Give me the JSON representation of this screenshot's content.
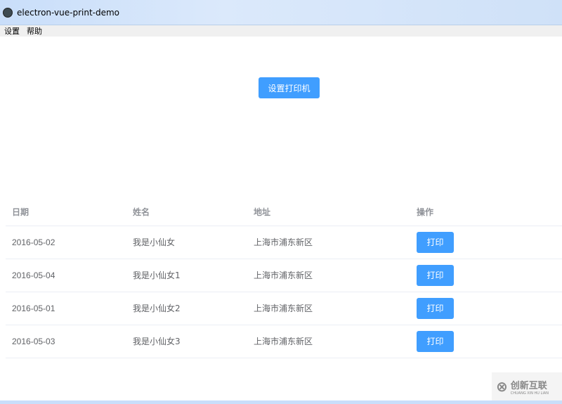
{
  "window": {
    "title": "electron-vue-print-demo"
  },
  "menu": [
    "设置",
    "帮助"
  ],
  "main": {
    "set_printer_label": "设置打印机"
  },
  "table": {
    "headers": [
      "日期",
      "姓名",
      "地址",
      "操作"
    ],
    "rows": [
      {
        "date": "2016-05-02",
        "name": "我是小仙女",
        "address": "上海市浦东新区",
        "action": "打印"
      },
      {
        "date": "2016-05-04",
        "name": "我是小仙女1",
        "address": "上海市浦东新区",
        "action": "打印"
      },
      {
        "date": "2016-05-01",
        "name": "我是小仙女2",
        "address": "上海市浦东新区",
        "action": "打印"
      },
      {
        "date": "2016-05-03",
        "name": "我是小仙女3",
        "address": "上海市浦东新区",
        "action": "打印"
      }
    ]
  },
  "watermark": {
    "text": "创新互联",
    "sub": "CHUANG XIN HU LIAN"
  },
  "colors": {
    "primary": "#409eff"
  }
}
